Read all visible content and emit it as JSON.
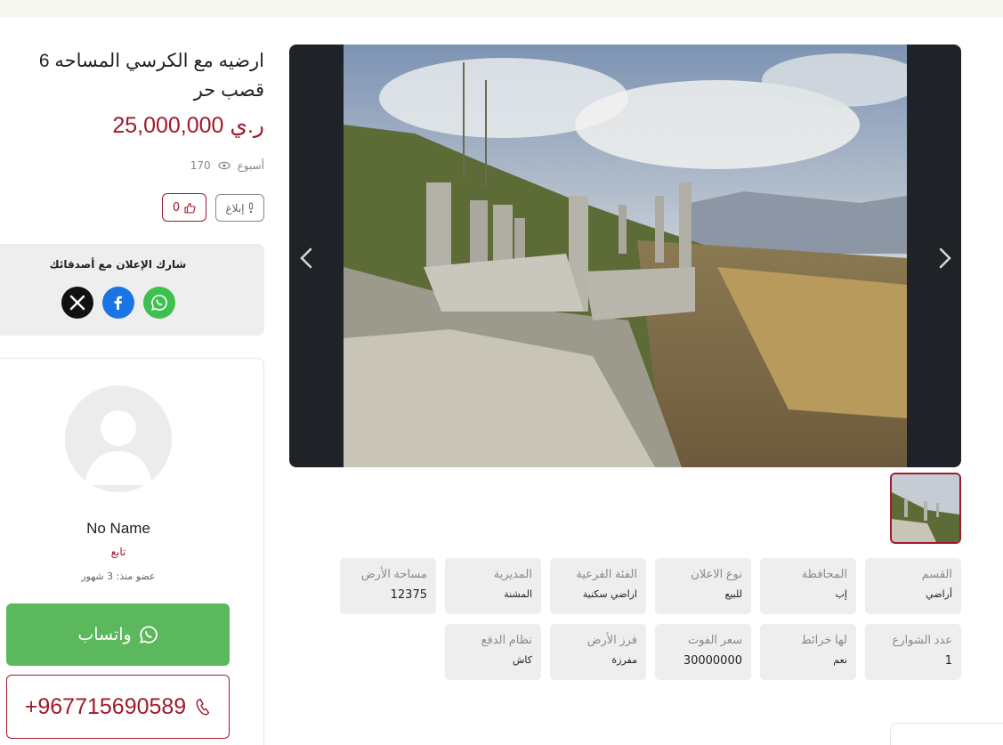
{
  "listing": {
    "title": "ارضيه مع الكرسي المساحه 6 قصب حر",
    "price": "25,000,000 ر.ي",
    "posted": "أسبوع",
    "views": "170",
    "report_label": "إبلاغ",
    "likes": "0"
  },
  "share": {
    "title": "شارك الإعلان مع أصدقائك",
    "icons": [
      "x-icon",
      "facebook-icon",
      "whatsapp-icon"
    ]
  },
  "seller": {
    "name": "No Name",
    "follow_label": "تابع",
    "member_since": "عضو منذ: 3 شهور"
  },
  "contact": {
    "whatsapp_label": "واتساب",
    "phone": "+967715690589"
  },
  "attributes": [
    {
      "label": "القسم",
      "value": "أراضي"
    },
    {
      "label": "المحافظة",
      "value": "إب"
    },
    {
      "label": "نوع الاعلان",
      "value": "للبيع"
    },
    {
      "label": "الفئة الفرعية",
      "value": "اراضي سكنية"
    },
    {
      "label": "المديرية",
      "value": "المشنة"
    },
    {
      "label": "مساحة الأرض",
      "value": "12375"
    },
    {
      "label": "عدد الشوارع",
      "value": "1"
    },
    {
      "label": "لها خرائط",
      "value": "نعم"
    },
    {
      "label": "سعر الفوت",
      "value": "30000000"
    },
    {
      "label": "فرز الأرض",
      "value": "مفرزة"
    },
    {
      "label": "نظام الدفع",
      "value": "كاش"
    }
  ],
  "colors": {
    "brand": "#a0192c",
    "whatsapp": "#5cb85c",
    "gallery_bg": "#1f2328"
  }
}
